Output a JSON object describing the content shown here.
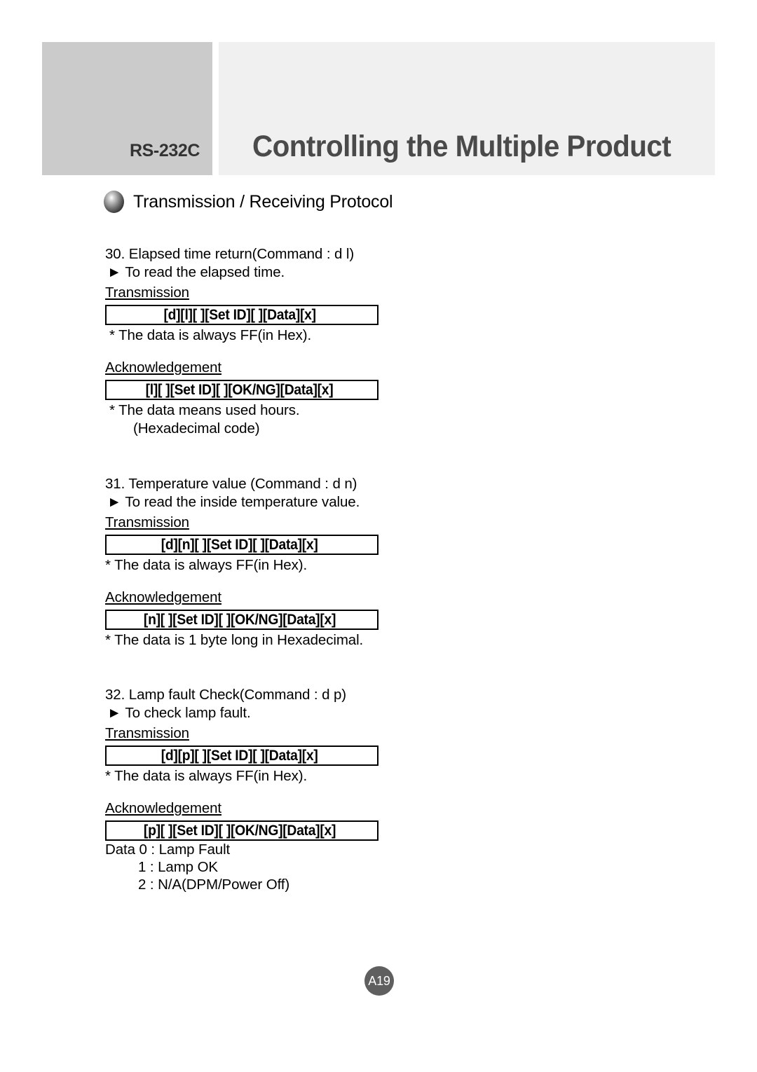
{
  "header": {
    "tag": "RS-232C",
    "title": "Controlling the Multiple Product",
    "tag_block_color": "#cbcbcb",
    "title_block_color": "#f0f0f0",
    "title_text_color": "#4a4a4a"
  },
  "protocol_heading": {
    "bullet_icon": "sphere-bullet-icon",
    "text": "Transmission / Receiving Protocol"
  },
  "sections": [
    {
      "title": "30. Elapsed time return(Command : d l)",
      "subtitle": "► To read the elapsed time.",
      "transmission_label": "Transmission",
      "transmission_command": "[d][l][ ][Set ID][ ][Data][x]",
      "transmission_note": "* The data is always FF(in Hex).",
      "acknowledgement_label": "Acknowledgement",
      "acknowledgement_command": "[l][ ][Set ID][ ][OK/NG][Data][x]",
      "acknowledgement_note": "* The data means used hours.",
      "acknowledgement_note2": "(Hexadecimal code)"
    },
    {
      "title": "31. Temperature value (Command : d n)",
      "subtitle": "► To read the inside temperature value.",
      "transmission_label": "Transmission",
      "transmission_command": "[d][n][ ][Set ID][ ][Data][x]",
      "transmission_note": "* The data is always FF(in Hex).",
      "acknowledgement_label": "Acknowledgement",
      "acknowledgement_command": "[n][ ][Set ID][ ][OK/NG][Data][x]",
      "acknowledgement_note": "* The data  is 1 byte long in Hexadecimal."
    },
    {
      "title": "32. Lamp fault Check(Command : d p)",
      "subtitle": "► To check lamp fault.",
      "transmission_label": "Transmission",
      "transmission_command": "[d][p][ ][Set ID][ ][Data][x]",
      "transmission_note": "* The data is always FF(in Hex).",
      "acknowledgement_label": "Acknowledgement",
      "acknowledgement_command": "[p][ ][Set ID][ ][OK/NG][Data][x]",
      "data_values": [
        "Data 0 : Lamp Fault",
        "1 : Lamp OK",
        "2 : N/A(DPM/Power Off)"
      ]
    }
  ],
  "footer": {
    "page_number": "A19",
    "badge_color": "#5f5f5f"
  }
}
